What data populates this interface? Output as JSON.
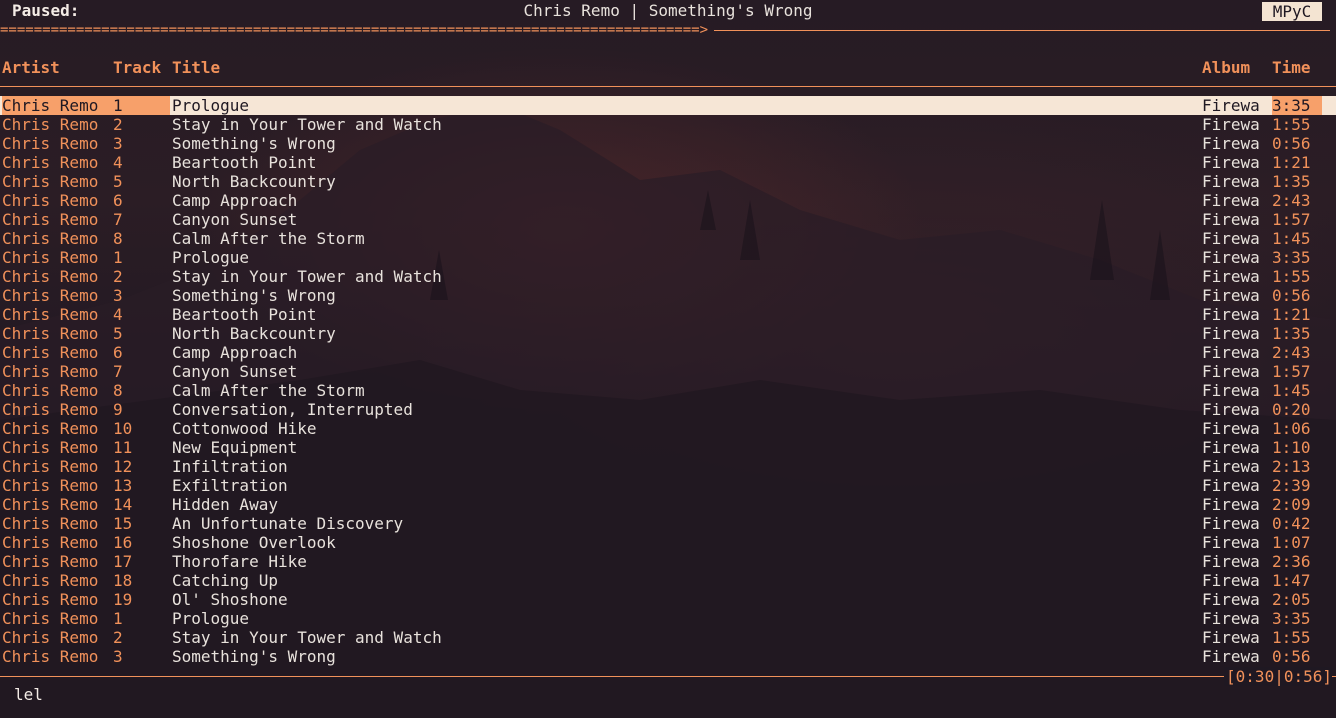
{
  "status": {
    "label": "Paused:"
  },
  "now_playing": "Chris Remo | Something's Wrong",
  "app_badge": "MPyC",
  "progress": {
    "elapsed_fraction": 0.535,
    "bar_glyph": "=",
    "head_glyph": ">"
  },
  "columns": {
    "artist": "Artist",
    "track": "Track",
    "title": "Title",
    "album": "Album",
    "time": "Time"
  },
  "tracks": [
    {
      "artist": "Chris Remo",
      "track": "1",
      "title": "Prologue",
      "album": "Firewa",
      "time": "3:35"
    },
    {
      "artist": "Chris Remo",
      "track": "2",
      "title": "Stay in Your Tower and Watch",
      "album": "Firewa",
      "time": "1:55"
    },
    {
      "artist": "Chris Remo",
      "track": "3",
      "title": "Something's Wrong",
      "album": "Firewa",
      "time": "0:56"
    },
    {
      "artist": "Chris Remo",
      "track": "4",
      "title": "Beartooth Point",
      "album": "Firewa",
      "time": "1:21"
    },
    {
      "artist": "Chris Remo",
      "track": "5",
      "title": "North Backcountry",
      "album": "Firewa",
      "time": "1:35"
    },
    {
      "artist": "Chris Remo",
      "track": "6",
      "title": "Camp Approach",
      "album": "Firewa",
      "time": "2:43"
    },
    {
      "artist": "Chris Remo",
      "track": "7",
      "title": "Canyon Sunset",
      "album": "Firewa",
      "time": "1:57"
    },
    {
      "artist": "Chris Remo",
      "track": "8",
      "title": "Calm After the Storm",
      "album": "Firewa",
      "time": "1:45"
    },
    {
      "artist": "Chris Remo",
      "track": "1",
      "title": "Prologue",
      "album": "Firewa",
      "time": "3:35"
    },
    {
      "artist": "Chris Remo",
      "track": "2",
      "title": "Stay in Your Tower and Watch",
      "album": "Firewa",
      "time": "1:55"
    },
    {
      "artist": "Chris Remo",
      "track": "3",
      "title": "Something's Wrong",
      "album": "Firewa",
      "time": "0:56"
    },
    {
      "artist": "Chris Remo",
      "track": "4",
      "title": "Beartooth Point",
      "album": "Firewa",
      "time": "1:21"
    },
    {
      "artist": "Chris Remo",
      "track": "5",
      "title": "North Backcountry",
      "album": "Firewa",
      "time": "1:35"
    },
    {
      "artist": "Chris Remo",
      "track": "6",
      "title": "Camp Approach",
      "album": "Firewa",
      "time": "2:43"
    },
    {
      "artist": "Chris Remo",
      "track": "7",
      "title": "Canyon Sunset",
      "album": "Firewa",
      "time": "1:57"
    },
    {
      "artist": "Chris Remo",
      "track": "8",
      "title": "Calm After the Storm",
      "album": "Firewa",
      "time": "1:45"
    },
    {
      "artist": "Chris Remo",
      "track": "9",
      "title": "Conversation, Interrupted",
      "album": "Firewa",
      "time": "0:20"
    },
    {
      "artist": "Chris Remo",
      "track": "10",
      "title": "Cottonwood Hike",
      "album": "Firewa",
      "time": "1:06"
    },
    {
      "artist": "Chris Remo",
      "track": "11",
      "title": "New Equipment",
      "album": "Firewa",
      "time": "1:10"
    },
    {
      "artist": "Chris Remo",
      "track": "12",
      "title": "Infiltration",
      "album": "Firewa",
      "time": "2:13"
    },
    {
      "artist": "Chris Remo",
      "track": "13",
      "title": "Exfiltration",
      "album": "Firewa",
      "time": "2:39"
    },
    {
      "artist": "Chris Remo",
      "track": "14",
      "title": "Hidden Away",
      "album": "Firewa",
      "time": "2:09"
    },
    {
      "artist": "Chris Remo",
      "track": "15",
      "title": "An Unfortunate Discovery",
      "album": "Firewa",
      "time": "0:42"
    },
    {
      "artist": "Chris Remo",
      "track": "16",
      "title": "Shoshone Overlook",
      "album": "Firewa",
      "time": "1:07"
    },
    {
      "artist": "Chris Remo",
      "track": "17",
      "title": "Thorofare Hike",
      "album": "Firewa",
      "time": "2:36"
    },
    {
      "artist": "Chris Remo",
      "track": "18",
      "title": "Catching Up",
      "album": "Firewa",
      "time": "1:47"
    },
    {
      "artist": "Chris Remo",
      "track": "19",
      "title": "Ol' Shoshone",
      "album": "Firewa",
      "time": "2:05"
    },
    {
      "artist": "Chris Remo",
      "track": "1",
      "title": "Prologue",
      "album": "Firewa",
      "time": "3:35"
    },
    {
      "artist": "Chris Remo",
      "track": "2",
      "title": "Stay in Your Tower and Watch",
      "album": "Firewa",
      "time": "1:55"
    },
    {
      "artist": "Chris Remo",
      "track": "3",
      "title": "Something's Wrong",
      "album": "Firewa",
      "time": "0:56"
    }
  ],
  "selected_index": 0,
  "time_display": "[0:30|0:56]",
  "command_line": "lel",
  "colors": {
    "accent": "#f1915a",
    "background": "#1f1822",
    "selection": "#f6e6d6",
    "selection_cell": "#f7a06a"
  }
}
